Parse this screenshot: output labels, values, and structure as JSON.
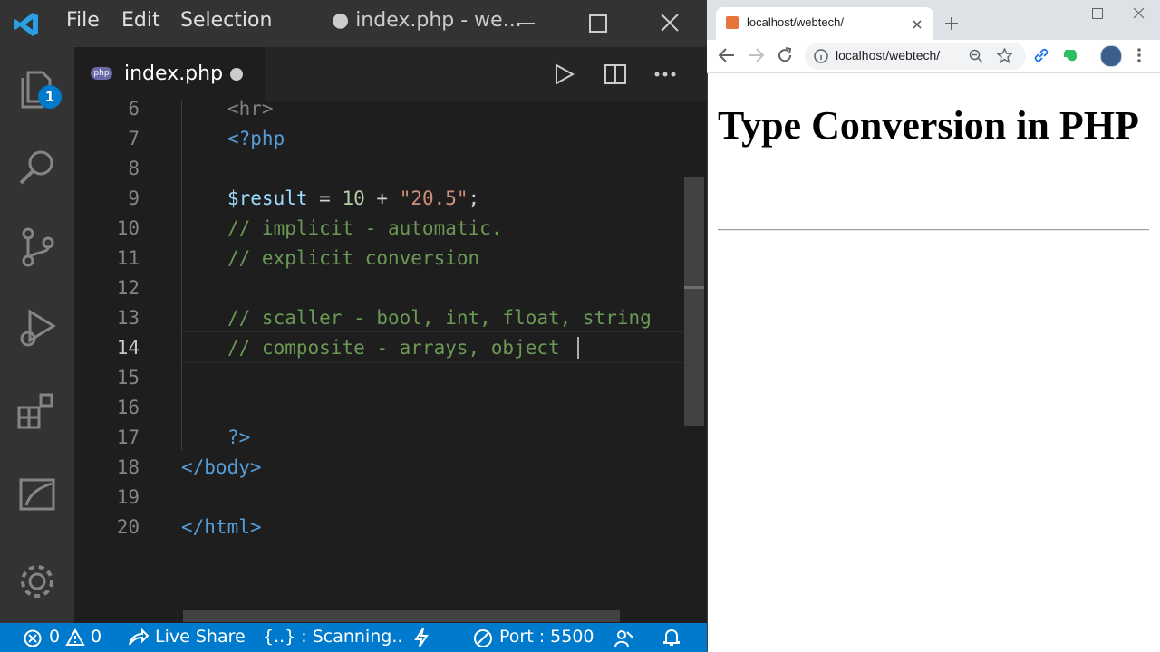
{
  "vscode": {
    "menu": [
      "File",
      "Edit",
      "Selection"
    ],
    "window_title": "● index.php - we...",
    "activity_badge": "1",
    "tab": {
      "label": "index.php",
      "icon_text": "php"
    },
    "lines": [
      {
        "num": "6"
      },
      {
        "num": "7"
      },
      {
        "num": "8"
      },
      {
        "num": "9"
      },
      {
        "num": "10"
      },
      {
        "num": "11"
      },
      {
        "num": "12"
      },
      {
        "num": "13"
      },
      {
        "num": "14"
      },
      {
        "num": "15"
      },
      {
        "num": "16"
      },
      {
        "num": "17"
      },
      {
        "num": "18"
      },
      {
        "num": "19"
      },
      {
        "num": "20"
      }
    ],
    "code": {
      "l6": "<hr>",
      "l7": "<?php",
      "l9_var": "$result",
      "l9_op1": " = ",
      "l9_num": "10",
      "l9_op2": " + ",
      "l9_str": "\"20.5\"",
      "l9_end": ";",
      "l10": "// implicit - automatic.",
      "l11": "// explicit conversion",
      "l13": "// scaller - bool, int, float, string",
      "l14": "// composite - arrays, object",
      "l17": "?>",
      "l18": "</body>",
      "l20": "</html>"
    },
    "status": {
      "errors": "0",
      "warnings": "0",
      "live_share": "Live Share",
      "scanning": "{..} : Scanning..",
      "port": "Port : 5500"
    },
    "colors": {
      "statusbar": "#007acc",
      "accent": "#007acc"
    }
  },
  "browser": {
    "tab_title": "localhost/webtech/",
    "url": "localhost/webtech/",
    "heading": "Type Conversion in PHP"
  }
}
